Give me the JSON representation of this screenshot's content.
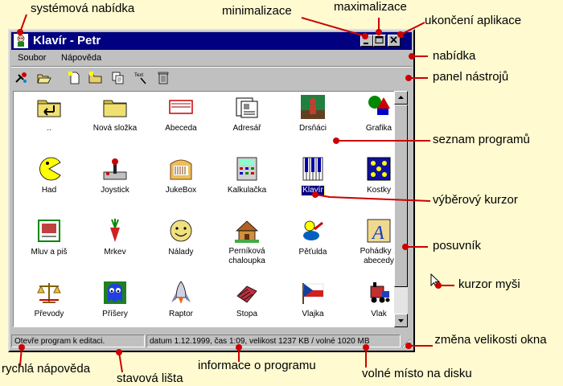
{
  "window": {
    "title": "Klavír - Petr",
    "menu": [
      "Soubor",
      "Nápověda"
    ],
    "toolbar_icons": [
      "tools-icon",
      "open-folder-icon",
      "new-file-icon",
      "new-folder-icon",
      "copy-icon",
      "text-icon",
      "trash-icon"
    ],
    "items": [
      {
        "label": "..",
        "icon": "folder-up-icon"
      },
      {
        "label": "Nová složka",
        "icon": "folder-icon"
      },
      {
        "label": "Abeceda",
        "icon": "abcd-icon"
      },
      {
        "label": "Adresář",
        "icon": "address-book-icon"
      },
      {
        "label": "Drsňáci",
        "icon": "tough-guys-icon"
      },
      {
        "label": "Grafika",
        "icon": "graphics-icon"
      },
      {
        "label": "Had",
        "icon": "pacman-icon"
      },
      {
        "label": "Joystick",
        "icon": "joystick-icon"
      },
      {
        "label": "JukeBox",
        "icon": "jukebox-icon"
      },
      {
        "label": "Kalkulačka",
        "icon": "calculator-icon"
      },
      {
        "label": "Klavír",
        "icon": "piano-icon",
        "selected": true
      },
      {
        "label": "Kostky",
        "icon": "dice-icon"
      },
      {
        "label": "Mluv a piš",
        "icon": "talk-write-icon"
      },
      {
        "label": "Mrkev",
        "icon": "carrot-icon"
      },
      {
        "label": "Nálady",
        "icon": "smiley-icon"
      },
      {
        "label": "Perníková chaloupka",
        "icon": "gingerbread-house-icon"
      },
      {
        "label": "Pěťulda",
        "icon": "petulda-icon"
      },
      {
        "label": "Pohádky z abecedy",
        "icon": "letter-a-icon"
      },
      {
        "label": "Převody",
        "icon": "scales-icon"
      },
      {
        "label": "Příšery",
        "icon": "ghost-icon"
      },
      {
        "label": "Raptor",
        "icon": "rocket-icon"
      },
      {
        "label": "Stopa",
        "icon": "track-icon"
      },
      {
        "label": "Vlajka",
        "icon": "czech-flag-icon"
      },
      {
        "label": "Vlak",
        "icon": "train-icon"
      }
    ],
    "status_help": "Otevře program k editaci.",
    "status_info": "datum 1.12.1999, čas 1:09, velikost 1237 KB / volné  1020 MB"
  },
  "annotations": {
    "system_menu": "systémová nabídka",
    "minimize": "minimalizace",
    "maximize": "maximalizace",
    "close": "ukončení aplikace",
    "menu": "nabídka",
    "toolbar": "panel nástrojů",
    "program_list": "seznam programů",
    "selection_cursor": "výběrový kurzor",
    "scrollbar": "posuvník",
    "mouse_cursor": "kurzor myši",
    "resize": "změna velikosti okna",
    "quick_help": "rychlá nápověda",
    "status_bar": "stavová lišta",
    "program_info": "informace o programu",
    "free_space": "volné místo na disku"
  },
  "colors": {
    "background": "#fffad0",
    "titlebar": "#000080",
    "window": "#c0c0c0",
    "selection": "#000080",
    "marker": "#cc0000"
  }
}
